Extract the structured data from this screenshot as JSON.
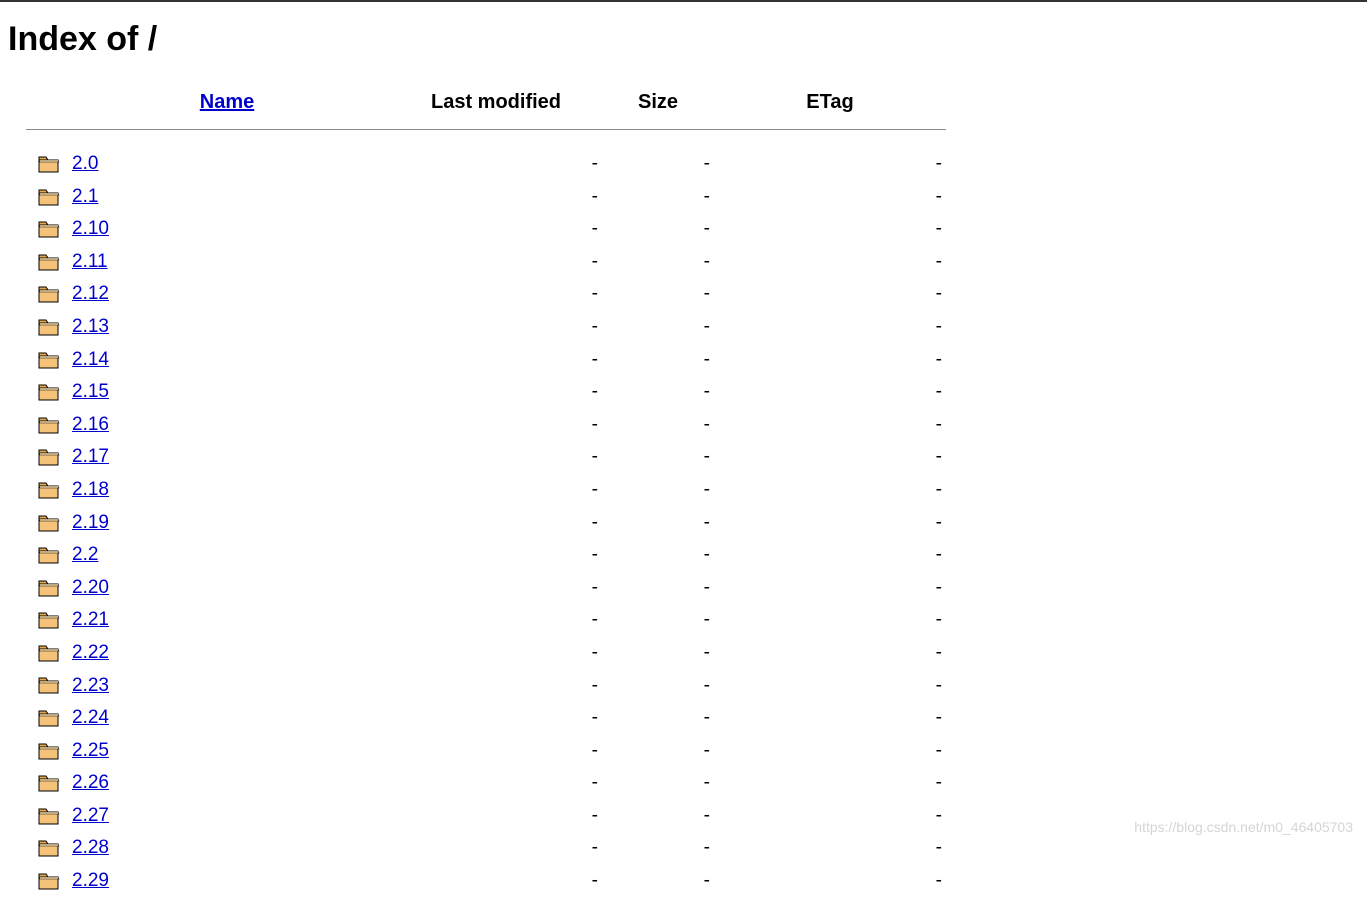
{
  "page": {
    "title": "Index of /"
  },
  "columns": {
    "name": "Name",
    "last_modified": "Last modified",
    "size": "Size",
    "etag": "ETag"
  },
  "placeholder": "-",
  "entries": [
    {
      "name": "2.0",
      "last_modified": "-",
      "size": "-",
      "etag": "-",
      "type": "dir"
    },
    {
      "name": "2.1",
      "last_modified": "-",
      "size": "-",
      "etag": "-",
      "type": "dir"
    },
    {
      "name": "2.10",
      "last_modified": "-",
      "size": "-",
      "etag": "-",
      "type": "dir"
    },
    {
      "name": "2.11",
      "last_modified": "-",
      "size": "-",
      "etag": "-",
      "type": "dir"
    },
    {
      "name": "2.12",
      "last_modified": "-",
      "size": "-",
      "etag": "-",
      "type": "dir"
    },
    {
      "name": "2.13",
      "last_modified": "-",
      "size": "-",
      "etag": "-",
      "type": "dir"
    },
    {
      "name": "2.14",
      "last_modified": "-",
      "size": "-",
      "etag": "-",
      "type": "dir"
    },
    {
      "name": "2.15",
      "last_modified": "-",
      "size": "-",
      "etag": "-",
      "type": "dir"
    },
    {
      "name": "2.16",
      "last_modified": "-",
      "size": "-",
      "etag": "-",
      "type": "dir"
    },
    {
      "name": "2.17",
      "last_modified": "-",
      "size": "-",
      "etag": "-",
      "type": "dir"
    },
    {
      "name": "2.18",
      "last_modified": "-",
      "size": "-",
      "etag": "-",
      "type": "dir"
    },
    {
      "name": "2.19",
      "last_modified": "-",
      "size": "-",
      "etag": "-",
      "type": "dir"
    },
    {
      "name": "2.2",
      "last_modified": "-",
      "size": "-",
      "etag": "-",
      "type": "dir"
    },
    {
      "name": "2.20",
      "last_modified": "-",
      "size": "-",
      "etag": "-",
      "type": "dir"
    },
    {
      "name": "2.21",
      "last_modified": "-",
      "size": "-",
      "etag": "-",
      "type": "dir"
    },
    {
      "name": "2.22",
      "last_modified": "-",
      "size": "-",
      "etag": "-",
      "type": "dir"
    },
    {
      "name": "2.23",
      "last_modified": "-",
      "size": "-",
      "etag": "-",
      "type": "dir"
    },
    {
      "name": "2.24",
      "last_modified": "-",
      "size": "-",
      "etag": "-",
      "type": "dir"
    },
    {
      "name": "2.25",
      "last_modified": "-",
      "size": "-",
      "etag": "-",
      "type": "dir"
    },
    {
      "name": "2.26",
      "last_modified": "-",
      "size": "-",
      "etag": "-",
      "type": "dir"
    },
    {
      "name": "2.27",
      "last_modified": "-",
      "size": "-",
      "etag": "-",
      "type": "dir"
    },
    {
      "name": "2.28",
      "last_modified": "-",
      "size": "-",
      "etag": "-",
      "type": "dir"
    },
    {
      "name": "2.29",
      "last_modified": "-",
      "size": "-",
      "etag": "-",
      "type": "dir"
    }
  ],
  "watermark": "https://blog.csdn.net/m0_46405703"
}
